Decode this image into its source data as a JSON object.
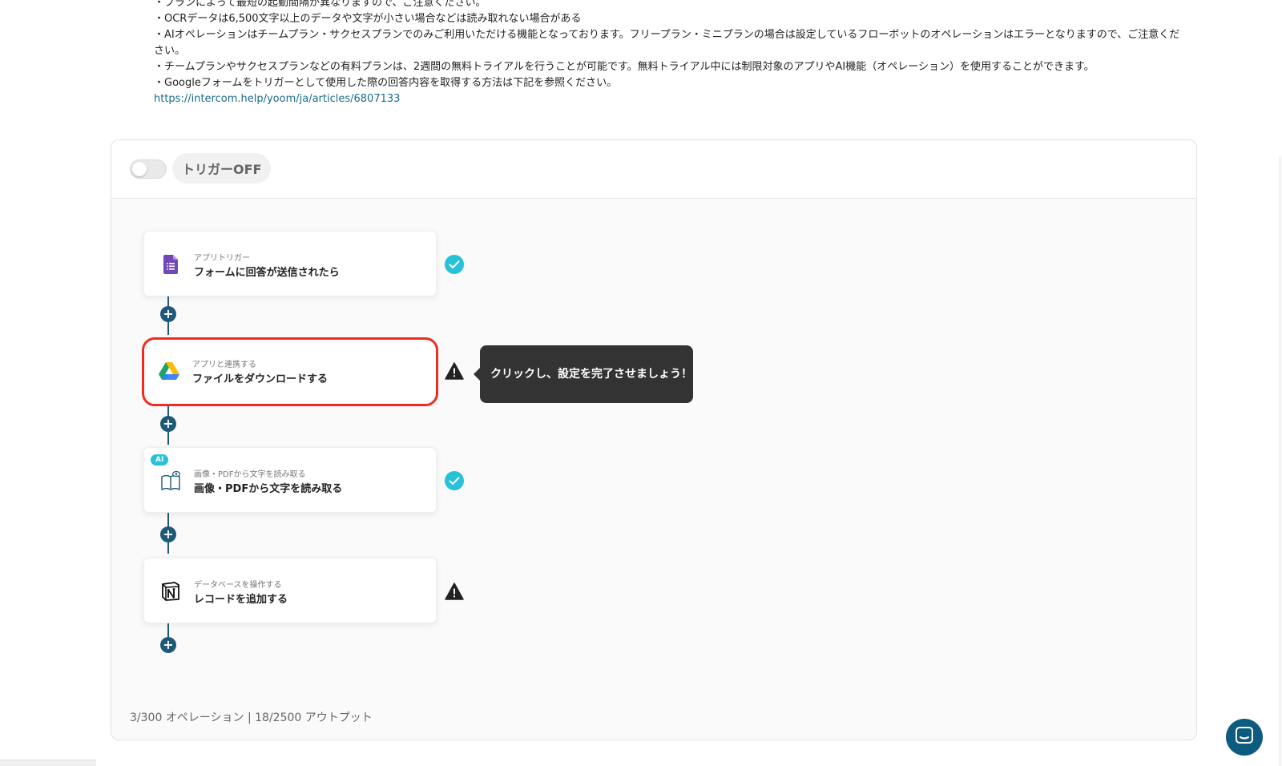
{
  "notes": {
    "lines": [
      "・プランによって最短の起動間隔が異なりますので、ご注意ください。",
      "・OCRデータは6,500文字以上のデータや文字が小さい場合などは読み取れない場合がある",
      "・AIオペレーションはチームプラン・サクセスプランでのみご利用いただける機能となっております。フリープラン・ミニプランの場合は設定しているフローボットのオペレーションはエラーとなりますので、ご注意ください。",
      "・チームプランやサクセスプランなどの有料プランは、2週間の無料トライアルを行うことが可能です。無料トライアル中には制限対象のアプリやAI機能（オペレーション）を使用することができます。",
      "・Googleフォームをトリガーとして使用した際の回答内容を取得する方法は下記を参照ください。"
    ],
    "link": "https://intercom.help/yoom/ja/articles/6807133"
  },
  "trigger": {
    "label": "トリガーOFF",
    "state": "off"
  },
  "steps": [
    {
      "small": "アプリトリガー",
      "title": "フォームに回答が送信されたら",
      "icon": "google-forms-icon",
      "status": "complete"
    },
    {
      "small": "アプリと連携する",
      "title": "ファイルをダウンロードする",
      "icon": "google-drive-icon",
      "status": "warning",
      "selected": true
    },
    {
      "small": "画像・PDFから文字を読み取る",
      "title": "画像・PDFから文字を読み取る",
      "icon": "ocr-book-icon",
      "status": "complete",
      "badge": "AI"
    },
    {
      "small": "データベースを操作する",
      "title": "レコードを追加する",
      "icon": "notion-icon",
      "status": "warning"
    }
  ],
  "tooltip": "クリックし、設定を完了させましょう！",
  "footer": "3/300 オペレーション | 18/2500 アウトプット",
  "colors": {
    "accent": "#1e5a78",
    "check": "#27c1da",
    "selected_border": "#ee2d20",
    "tooltip_bg": "#333333"
  }
}
